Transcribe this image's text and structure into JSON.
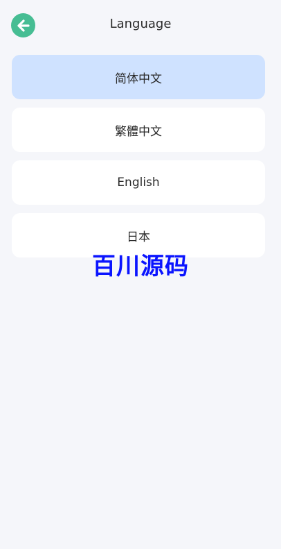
{
  "header": {
    "title": "Language",
    "back_icon": "arrow-left-icon"
  },
  "colors": {
    "accent": "#46bd93",
    "selected_bg": "#cfe2ff",
    "page_bg": "#f5f6fa",
    "watermark": "#0a14ff"
  },
  "languages": [
    {
      "label": "简体中文",
      "selected": true
    },
    {
      "label": "繁體中文",
      "selected": false
    },
    {
      "label": "English",
      "selected": false
    },
    {
      "label": "日本",
      "selected": false
    }
  ],
  "watermark": {
    "text": "百川源码"
  }
}
